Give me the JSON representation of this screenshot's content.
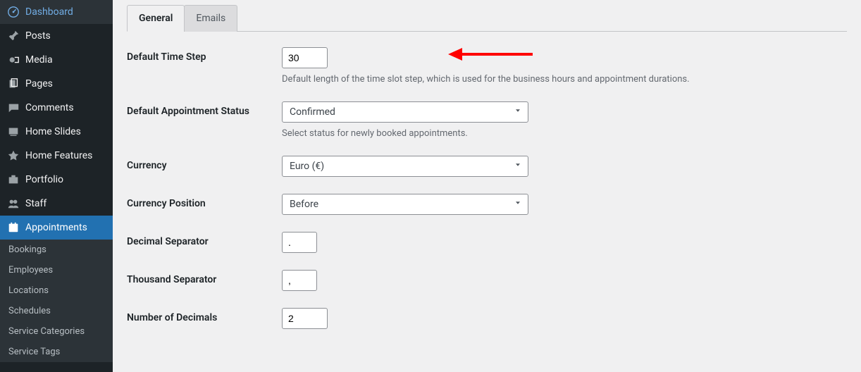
{
  "sidebar": {
    "items": [
      {
        "label": "Dashboard",
        "icon": "dashboard"
      },
      {
        "label": "Posts",
        "icon": "pin"
      },
      {
        "label": "Media",
        "icon": "media"
      },
      {
        "label": "Pages",
        "icon": "pages"
      },
      {
        "label": "Comments",
        "icon": "comments"
      },
      {
        "label": "Home Slides",
        "icon": "slides"
      },
      {
        "label": "Home Features",
        "icon": "star"
      },
      {
        "label": "Portfolio",
        "icon": "portfolio"
      },
      {
        "label": "Staff",
        "icon": "staff"
      },
      {
        "label": "Appointments",
        "icon": "calendar",
        "active": true
      }
    ],
    "submenu": [
      {
        "label": "Bookings"
      },
      {
        "label": "Employees"
      },
      {
        "label": "Locations"
      },
      {
        "label": "Schedules"
      },
      {
        "label": "Service Categories"
      },
      {
        "label": "Service Tags"
      }
    ]
  },
  "tabs": [
    {
      "label": "General",
      "active": true
    },
    {
      "label": "Emails",
      "active": false
    }
  ],
  "form": {
    "time_step": {
      "label": "Default Time Step",
      "value": "30",
      "hint": "Default length of the time slot step, which is used for the business hours and appointment durations."
    },
    "appt_status": {
      "label": "Default Appointment Status",
      "value": "Confirmed",
      "hint": "Select status for newly booked appointments."
    },
    "currency": {
      "label": "Currency",
      "value": "Euro (€)"
    },
    "currency_pos": {
      "label": "Currency Position",
      "value": "Before"
    },
    "decimal_sep": {
      "label": "Decimal Separator",
      "value": "."
    },
    "thousand_sep": {
      "label": "Thousand Separator",
      "value": ","
    },
    "num_decimals": {
      "label": "Number of Decimals",
      "value": "2"
    }
  }
}
